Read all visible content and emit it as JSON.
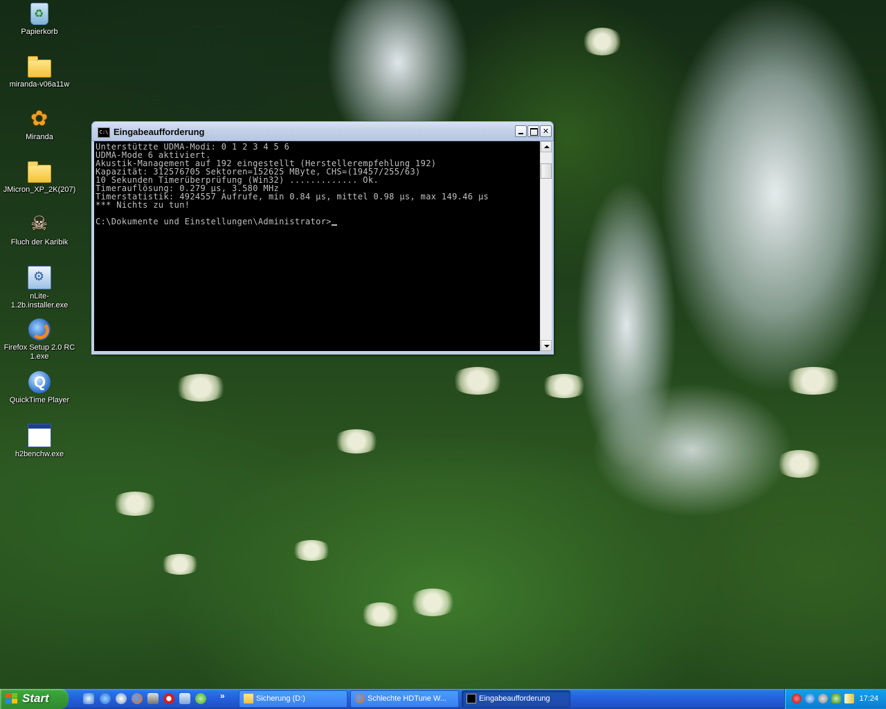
{
  "desktop": {
    "icons": [
      {
        "label": "Papierkorb",
        "icon": "recycle-bin-icon"
      },
      {
        "label": "miranda-v06a11w",
        "icon": "folder-icon"
      },
      {
        "label": "Miranda",
        "icon": "miranda-icon"
      },
      {
        "label": "JMicron_XP_2K(207)",
        "icon": "folder-icon"
      },
      {
        "label": "Fluch der Karibik",
        "icon": "pirate-skull-icon"
      },
      {
        "label": "nLite-1.2b.installer.exe",
        "icon": "installer-icon"
      },
      {
        "label": "Firefox Setup 2.0 RC 1.exe",
        "icon": "firefox-setup-icon"
      },
      {
        "label": "QuickTime Player",
        "icon": "quicktime-icon"
      },
      {
        "label": "h2benchw.exe",
        "icon": "exe-icon"
      }
    ]
  },
  "console": {
    "title": "Eingabeaufforderung",
    "lines": [
      "Unterstützte UDMA-Modi: 0 1 2 3 4 5 6",
      "UDMA-Mode 6 aktiviert.",
      "Akustik-Management auf 192 eingestellt (Herstellerempfehlung 192)",
      "Kapazität: 312576705 Sektoren=152625 MByte, CHS=(19457/255/63)",
      "10 Sekunden Timerüberprüfung (Win32) ............. Ok.",
      "Timerauflösung: 0.279 µs, 3.580 MHz",
      "Timerstatistik: 4924557 Aufrufe, min 0.84 µs, mittel 0.98 µs, max 149.46 µs",
      "*** Nichts zu tun!",
      "",
      "C:\\Dokumente und Einstellungen\\Administrator>"
    ]
  },
  "taskbar": {
    "start_label": "Start",
    "quick_launch": [
      "outlook-express-icon",
      "internet-explorer-icon",
      "media-player-icon",
      "firefox-icon",
      "app-icon",
      "opera-icon",
      "desktop-icon",
      "utorrent-icon"
    ],
    "quick_launch_more": "»",
    "buttons": [
      {
        "label": "Sicherung (D:)",
        "icon": "folder-icon",
        "active": false
      },
      {
        "label": "Schlechte HDTune W...",
        "icon": "firefox-icon",
        "active": false
      },
      {
        "label": "Eingabeaufforderung",
        "icon": "console-icon",
        "active": true
      }
    ],
    "tray_icons": [
      "antivirus-icon",
      "quicktime-tray-icon",
      "network-icon",
      "security-icon",
      "volume-icon"
    ],
    "clock": "17:24"
  },
  "colors": {
    "taskbar_blue": "#245edb",
    "start_green": "#379c37",
    "console_bg": "#000000",
    "console_text": "#c0c0c0"
  }
}
